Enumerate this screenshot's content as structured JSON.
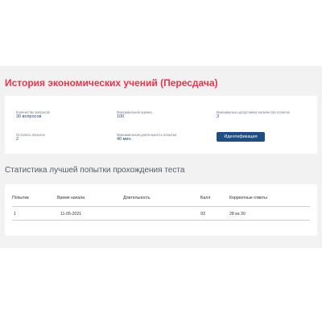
{
  "page": {
    "title": "История экономических учений (Пересдача)"
  },
  "info": {
    "questions_label": "Количество вопросов",
    "questions_value": "30 вопросов",
    "max_score_label": "Максимальная оценка",
    "max_score_value": "100",
    "max_attempts_label": "Максимально допустимое количество попыток",
    "max_attempts_value": "3",
    "remaining_label": "Осталось попыток",
    "remaining_value": "2",
    "max_duration_label": "Максимальная длительность попытки",
    "max_duration_value": "40 мин.",
    "identify_button": "Идентификация"
  },
  "stats": {
    "section_title": "Статистика лучшей попытки прохождения теста",
    "columns": [
      "Попытки",
      "Время начала",
      "Длительность",
      "Балл",
      "Корректные ответы"
    ],
    "rows": [
      [
        "1",
        "11-05-2021",
        "",
        "93",
        "28 из 30"
      ]
    ]
  },
  "colors": {
    "title": "#e8334a",
    "button": "#1f4e82",
    "value_text": "#2c4a78"
  }
}
